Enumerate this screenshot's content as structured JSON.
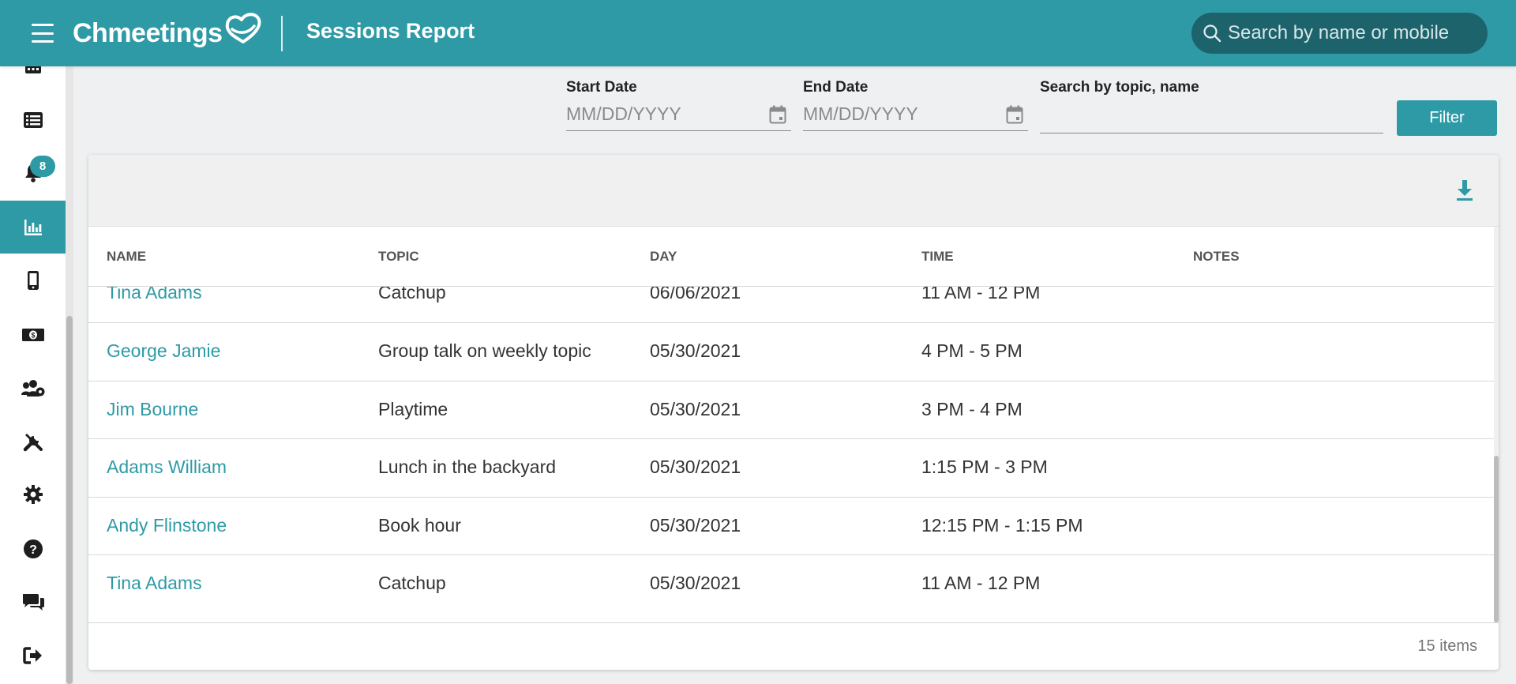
{
  "header": {
    "logo_text": "Chmeetings",
    "title": "Sessions Report",
    "search_placeholder": "Search by name or mobile"
  },
  "sidebar": {
    "items": [
      {
        "icon": "calendar-grid-icon",
        "active": false
      },
      {
        "icon": "list-icon",
        "active": false
      },
      {
        "icon": "bell-icon",
        "active": false,
        "badge": "8"
      },
      {
        "icon": "chart-bars-icon",
        "active": true
      },
      {
        "icon": "mobile-phone-icon",
        "active": false
      },
      {
        "icon": "money-bill-icon",
        "active": false
      },
      {
        "icon": "users-cog-icon",
        "active": false
      },
      {
        "icon": "tools-icon",
        "active": false
      },
      {
        "icon": "gear-icon",
        "active": false
      },
      {
        "icon": "help-circle-icon",
        "active": false
      },
      {
        "icon": "chat-bubbles-icon",
        "active": false
      },
      {
        "icon": "sign-out-icon",
        "active": false
      }
    ]
  },
  "filters": {
    "start_date_label": "Start Date",
    "start_date_placeholder": "MM/DD/YYYY",
    "end_date_label": "End Date",
    "end_date_placeholder": "MM/DD/YYYY",
    "search_label": "Search by topic, name",
    "search_value": "",
    "filter_button": "Filter"
  },
  "table": {
    "columns": [
      "NAME",
      "TOPIC",
      "DAY",
      "TIME",
      "NOTES"
    ],
    "rows": [
      {
        "name": "Tina Adams",
        "topic": "Catchup",
        "day": "06/06/2021",
        "time": "11 AM - 12 PM",
        "notes": ""
      },
      {
        "name": "George Jamie",
        "topic": "Group talk on weekly topic",
        "day": "05/30/2021",
        "time": "4 PM - 5 PM",
        "notes": ""
      },
      {
        "name": "Jim Bourne",
        "topic": "Playtime",
        "day": "05/30/2021",
        "time": "3 PM - 4 PM",
        "notes": ""
      },
      {
        "name": "Adams William",
        "topic": "Lunch in the backyard",
        "day": "05/30/2021",
        "time": "1:15 PM - 3 PM",
        "notes": ""
      },
      {
        "name": "Andy Flinstone",
        "topic": "Book hour",
        "day": "05/30/2021",
        "time": "12:15 PM - 1:15 PM",
        "notes": ""
      },
      {
        "name": "Tina Adams",
        "topic": "Catchup",
        "day": "05/30/2021",
        "time": "11 AM - 12 PM",
        "notes": ""
      }
    ],
    "items_count": "15 items"
  },
  "colors": {
    "brand": "#2e9aa6",
    "search_bg": "#1d636b",
    "page_bg": "#eef0f1"
  }
}
